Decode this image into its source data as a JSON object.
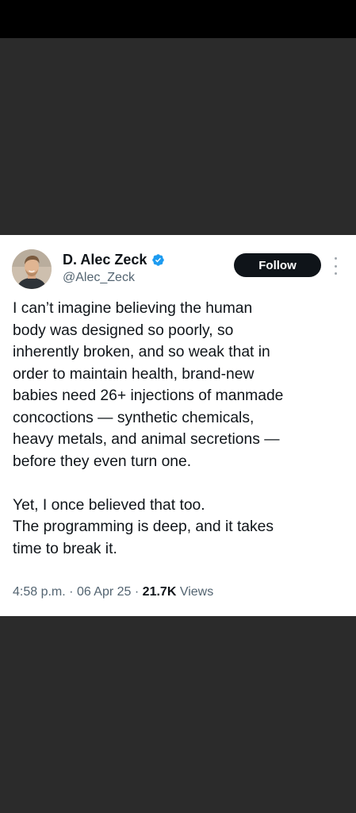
{
  "tweet": {
    "author": {
      "display_name": "D. Alec Zeck",
      "handle": "@Alec_Zeck",
      "verified_icon": "verified-badge-icon",
      "avatar_icon": "profile-photo"
    },
    "follow_label": "Follow",
    "more_icon": "more-vertical-icon",
    "paragraphs": [
      "I can’t imagine believing the human body was designed so poorly, so inherently broken, and so weak that in order to maintain health, brand-new babies need 26+ injections of manmade concoctions — synthetic chemicals, heavy metals, and animal secretions — before they even turn one.",
      "Yet, I once believed that too.\nThe programming is deep, and it takes time to break it."
    ],
    "body_text": "I can’t imagine believing the human\nbody was designed so poorly, so\ninherently broken, and so weak that in\norder to maintain health, brand-new\nbabies need 26+ injections of manmade\nconcoctions — synthetic chemicals,\nheavy metals, and animal secretions —\nbefore they even turn one.\n\nYet, I once believed that too.\nThe programming is deep, and it takes\ntime to break it.",
    "meta": {
      "time": "4:58 p.m.",
      "separator": "·",
      "date": "06 Apr 25",
      "views_count": "21.7K",
      "views_label": "Views"
    }
  },
  "colors": {
    "background_dark": "#2b2b2b",
    "status_bar": "#000000",
    "card": "#ffffff",
    "text_primary": "#0f1419",
    "text_secondary": "#536471",
    "verified_blue": "#1d9bf0",
    "button_bg": "#0f1419"
  }
}
